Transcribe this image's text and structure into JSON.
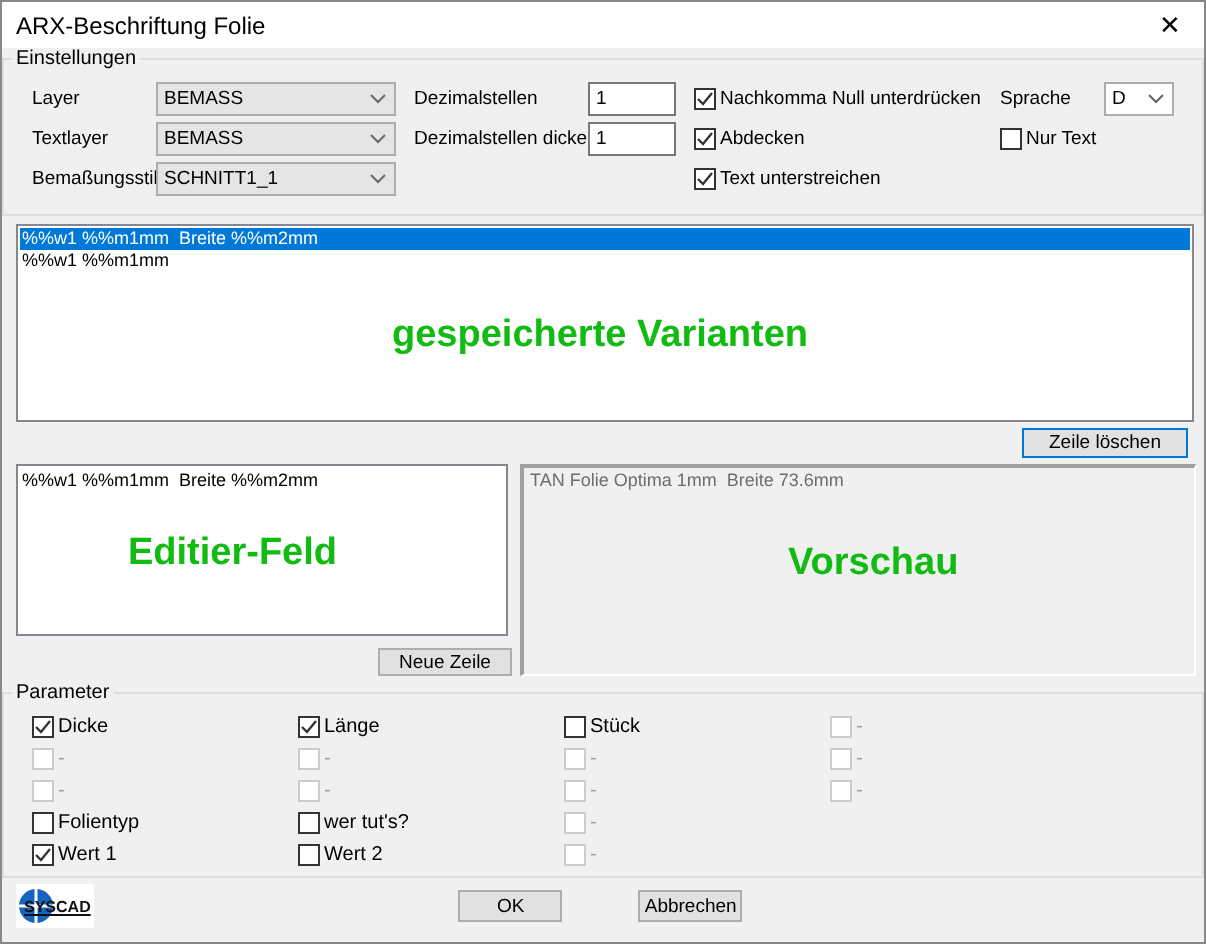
{
  "window": {
    "title": "ARX-Beschriftung Folie",
    "close": "✕"
  },
  "settings": {
    "title": "Einstellungen",
    "combos": [
      {
        "label": "Layer",
        "value": "BEMASS"
      },
      {
        "label": "Textlayer",
        "value": "BEMASS"
      },
      {
        "label": "Bemaßungsstil",
        "value": "SCHNITT1_1"
      }
    ],
    "fields": [
      {
        "label": "Dezimalstellen",
        "value": "1"
      },
      {
        "label": "Dezimalstellen dicke",
        "value": "1"
      }
    ],
    "options": [
      {
        "label": "Nachkomma Null unterdrücken",
        "checked": true
      },
      {
        "label": "Abdecken",
        "checked": true
      },
      {
        "label": "Text unterstreichen",
        "checked": true
      }
    ],
    "language": {
      "label": "Sprache",
      "value": "D"
    },
    "text_only": {
      "label": "Nur Text",
      "checked": false
    }
  },
  "variants": {
    "items": [
      {
        "text": "%%w1 %%m1mm  Breite %%m2mm",
        "selected": true
      },
      {
        "text": "%%w1 %%m1mm",
        "selected": false
      }
    ],
    "annotation": "gespeicherte Varianten",
    "delete_button": "Zeile löschen"
  },
  "editor": {
    "value": "%%w1 %%m1mm  Breite %%m2mm",
    "annotation": "Editier-Feld",
    "new_line_button": "Neue Zeile"
  },
  "preview": {
    "text": "TAN Folie Optima 1mm  Breite 73.6mm",
    "annotation": "Vorschau"
  },
  "parameters": {
    "title": "Parameter",
    "columns": [
      [
        {
          "label": "Dicke",
          "checked": true,
          "disabled": false
        },
        {
          "label": "-",
          "checked": false,
          "disabled": true
        },
        {
          "label": "-",
          "checked": false,
          "disabled": true
        },
        {
          "label": "Folientyp",
          "checked": false,
          "disabled": false
        },
        {
          "label": "Wert 1",
          "checked": true,
          "disabled": false
        }
      ],
      [
        {
          "label": "Länge",
          "checked": true,
          "disabled": false
        },
        {
          "label": "-",
          "checked": false,
          "disabled": true
        },
        {
          "label": "-",
          "checked": false,
          "disabled": true
        },
        {
          "label": "wer tut's?",
          "checked": false,
          "disabled": false
        },
        {
          "label": "Wert 2",
          "checked": false,
          "disabled": false
        }
      ],
      [
        {
          "label": "Stück",
          "checked": false,
          "disabled": false
        },
        {
          "label": "-",
          "checked": false,
          "disabled": true
        },
        {
          "label": "-",
          "checked": false,
          "disabled": true
        },
        {
          "label": "-",
          "checked": false,
          "disabled": true
        },
        {
          "label": "-",
          "checked": false,
          "disabled": true
        }
      ],
      [
        {
          "label": "-",
          "checked": false,
          "disabled": true
        },
        {
          "label": "-",
          "checked": false,
          "disabled": true
        },
        {
          "label": "-",
          "checked": false,
          "disabled": true
        }
      ]
    ]
  },
  "logo": "SYSCAD",
  "buttons": [
    "OK",
    "Abbrechen"
  ]
}
